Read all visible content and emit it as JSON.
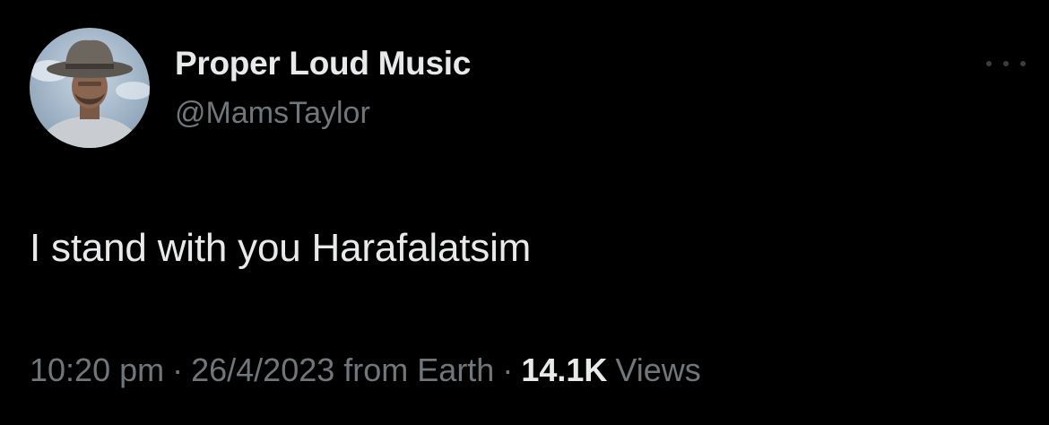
{
  "author": {
    "display_name": "Proper Loud Music",
    "handle": "@MamsTaylor",
    "avatar_icon": "profile-photo-cowboy-hat"
  },
  "tweet": {
    "text": "I stand with you Harafalatsim"
  },
  "meta": {
    "time": "10:20 pm",
    "separator": "·",
    "date": "26/4/2023",
    "source": "from Earth",
    "views_count": "14.1K",
    "views_label": "Views"
  },
  "menu": {
    "icon": "more-horizontal-icon"
  },
  "colors": {
    "background": "#000000",
    "primary_text": "#e7e9ea",
    "secondary_text": "#71767b"
  }
}
